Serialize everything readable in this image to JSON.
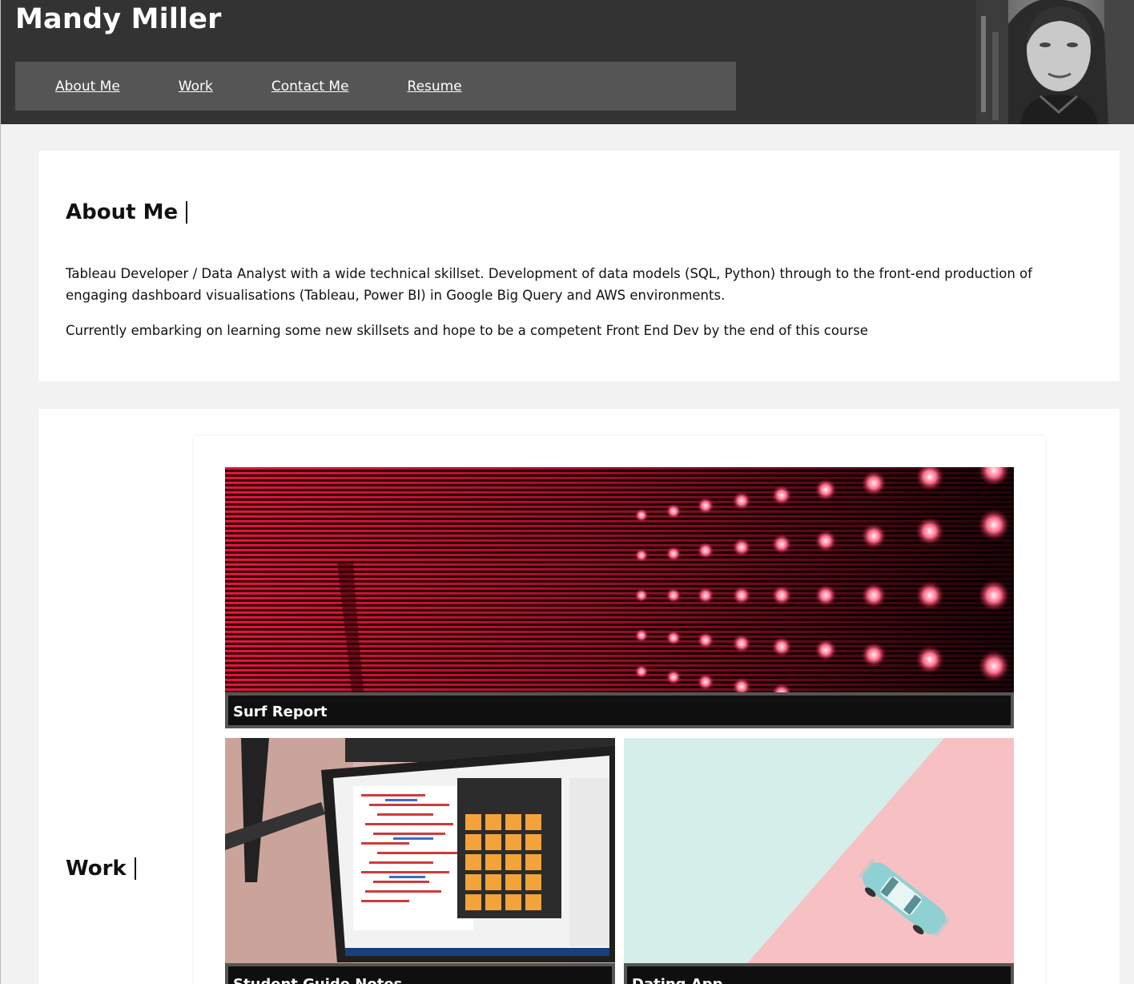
{
  "header": {
    "title": "Mandy Miller",
    "nav": [
      "About Me",
      "Work",
      "Contact Me",
      "Resume"
    ]
  },
  "about": {
    "heading": "About Me",
    "p1": "Tableau Developer / Data Analyst with a wide technical skillset. Development of data models (SQL, Python) through to the front-end production of engaging dashboard visualisations (Tableau, Power BI) in Google Big Query and AWS environments.",
    "p2": "Currently embarking on learning some new skillsets and hope to be a competent Front End Dev by the end of this course"
  },
  "work": {
    "heading": "Work",
    "projects": [
      "Surf Report",
      "Student Guide Notes",
      "Dating App"
    ]
  },
  "colors": {
    "header_bg": "#333333",
    "nav_bg": "#555555",
    "page_bg": "#f2f2f2"
  }
}
